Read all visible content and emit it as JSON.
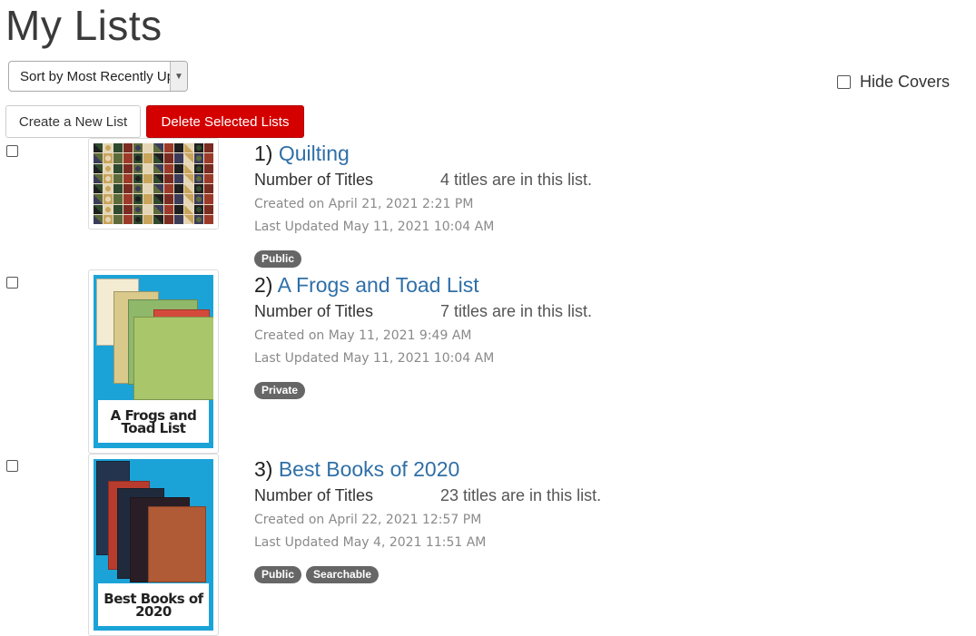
{
  "page": {
    "title": "My Lists",
    "sort_selected": "Sort by Most Recently Up",
    "hide_covers_label": "Hide Covers",
    "create_button": "Create a New List",
    "delete_button": "Delete Selected Lists"
  },
  "lists": [
    {
      "index": "1)",
      "name": "Quilting",
      "count_label": "Number of Titles",
      "count_text": "4 titles are in this list.",
      "created": "Created on April 21, 2021 2:21 PM",
      "updated": "Last Updated May 11, 2021 10:04 AM",
      "badges": [
        "Public"
      ]
    },
    {
      "index": "2)",
      "name": "A Frogs and Toad List",
      "count_label": "Number of Titles",
      "count_text": "7 titles are in this list.",
      "created": "Created on May 11, 2021 9:49 AM",
      "updated": "Last Updated May 11, 2021 10:04 AM",
      "badges": [
        "Private"
      ],
      "cover_caption": "A Frogs and Toad List"
    },
    {
      "index": "3)",
      "name": "Best Books of 2020",
      "count_label": "Number of Titles",
      "count_text": "23 titles are in this list.",
      "created": "Created on April 22, 2021 12:57 PM",
      "updated": "Last Updated May 4, 2021 11:51 AM",
      "badges": [
        "Public",
        "Searchable"
      ],
      "cover_caption": "Best Books of 2020"
    }
  ],
  "colors": {
    "link": "#2f6fa7",
    "delete_button": "#d40000",
    "badge": "#666666",
    "cover_blue": "#1ba3d8"
  }
}
